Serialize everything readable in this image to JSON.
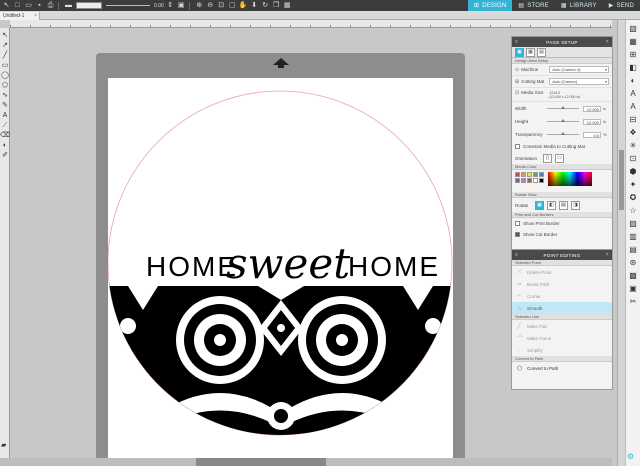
{
  "topbar": {
    "tabs": [
      {
        "icon": "⊞",
        "label": "DESIGN",
        "active": true
      },
      {
        "icon": "▤",
        "label": "STORE",
        "active": false
      },
      {
        "icon": "▦",
        "label": "LIBRARY",
        "active": false
      },
      {
        "icon": "▶",
        "label": "SEND",
        "active": false
      }
    ],
    "line_width_value": "0.00"
  },
  "document_tab": {
    "label": "Untitled-1"
  },
  "design": {
    "words": [
      "HOME",
      "sweet",
      "HOME"
    ]
  },
  "page_setup": {
    "title": "PAGE SETUP",
    "section_design_area": "Design Area Setup",
    "machine_label": "Machine",
    "machine_value": "Auto (Cameo 4)",
    "cutting_mat_label": "Cutting Mat",
    "cutting_mat_value": "Auto (Cameo)",
    "media_size_label": "Media Size",
    "media_size_value": "12x12",
    "media_size_detail": "(12.000 x 12.000 in)",
    "width_label": "Width",
    "width_value": "12.000",
    "height_label": "Height",
    "height_value": "12.000",
    "transparency_label": "Transparency",
    "transparency_value": "0.0",
    "transparency_unit": "%",
    "unit_in": "in",
    "constrain_label": "Constrain Media to Cutting Mat",
    "orientation_label": "Orientation",
    "section_media_color": "Media Color",
    "swatch_colors": [
      "#e04040",
      "#f0a030",
      "#f0e040",
      "#50b050",
      "#4080d0",
      "#8050c0",
      "#e070a0",
      "#a06030",
      "#ffffff",
      "#000000"
    ],
    "section_rotate_view": "Rotate View",
    "rotate_label": "Rotate",
    "rotate_buttons": [
      "0°",
      "90°",
      "180°",
      "270°"
    ],
    "section_print_cut": "Print and Cut Borders",
    "show_print_border_label": "Show Print Border",
    "show_cut_border_label": "Show Cut Border"
  },
  "point_editing": {
    "title": "POINT EDITING",
    "section_selected_point": "Selected Point",
    "delete_point": "Delete Point",
    "break_path": "Break Path",
    "corner": "Corner",
    "smooth": "Smooth",
    "section_selected_line": "Selected Line",
    "make_flat": "Make Flat",
    "make_curve": "Make Curve",
    "simplify": "Simplify",
    "section_convert": "Convert to Path",
    "convert_to_path": "Convert to Path"
  }
}
